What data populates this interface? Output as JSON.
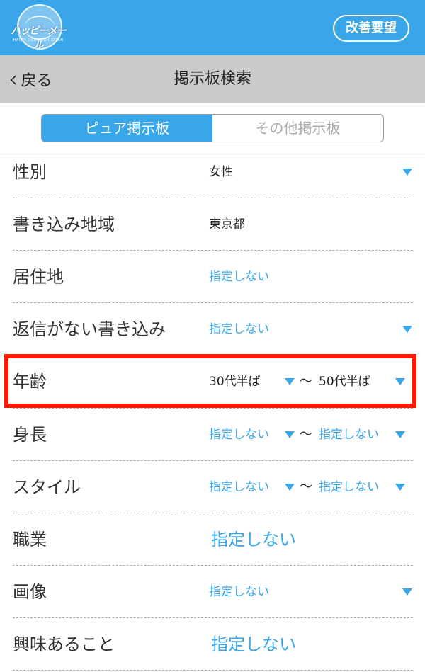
{
  "header": {
    "brand_logo_text": "ハッピーメール",
    "brand_sub": "HAPPY COMMUNICATION",
    "request_button": "改善要望",
    "bar_color": "#3aa6ea"
  },
  "nav": {
    "back_label": "戻る",
    "title": "掲示板検索"
  },
  "tabs": [
    {
      "label": "ピュア掲示板",
      "active": true
    },
    {
      "label": "その他掲示板",
      "active": false
    }
  ],
  "filters": [
    {
      "label": "性別",
      "value": "女性",
      "has_dropdown": true
    },
    {
      "label": "書き込み地域",
      "value": "東京都",
      "has_dropdown": false
    },
    {
      "label": "居住地",
      "value": "指定しない",
      "has_dropdown": false
    },
    {
      "label": "返信がない書き込み",
      "value": "指定しない",
      "has_dropdown": true
    },
    {
      "label": "年齢",
      "from": "30代半ば",
      "tilde": "〜",
      "to": "50代半ば",
      "highlighted": true
    },
    {
      "label": "身長",
      "from": "指定しない",
      "tilde": "〜",
      "to": "指定しない"
    },
    {
      "label": "スタイル",
      "from": "指定しない",
      "tilde": "〜",
      "to": "指定しない"
    },
    {
      "label": "職業",
      "value": "指定しない",
      "has_dropdown": false
    },
    {
      "label": "画像",
      "value": "指定しない",
      "has_dropdown": true
    },
    {
      "label": "興味あること",
      "value": "指定しない",
      "has_dropdown": false
    }
  ],
  "colors": {
    "accent": "#3aa6ea",
    "highlight_border": "#ff1a00",
    "nav_bg": "#cbcbcb"
  }
}
